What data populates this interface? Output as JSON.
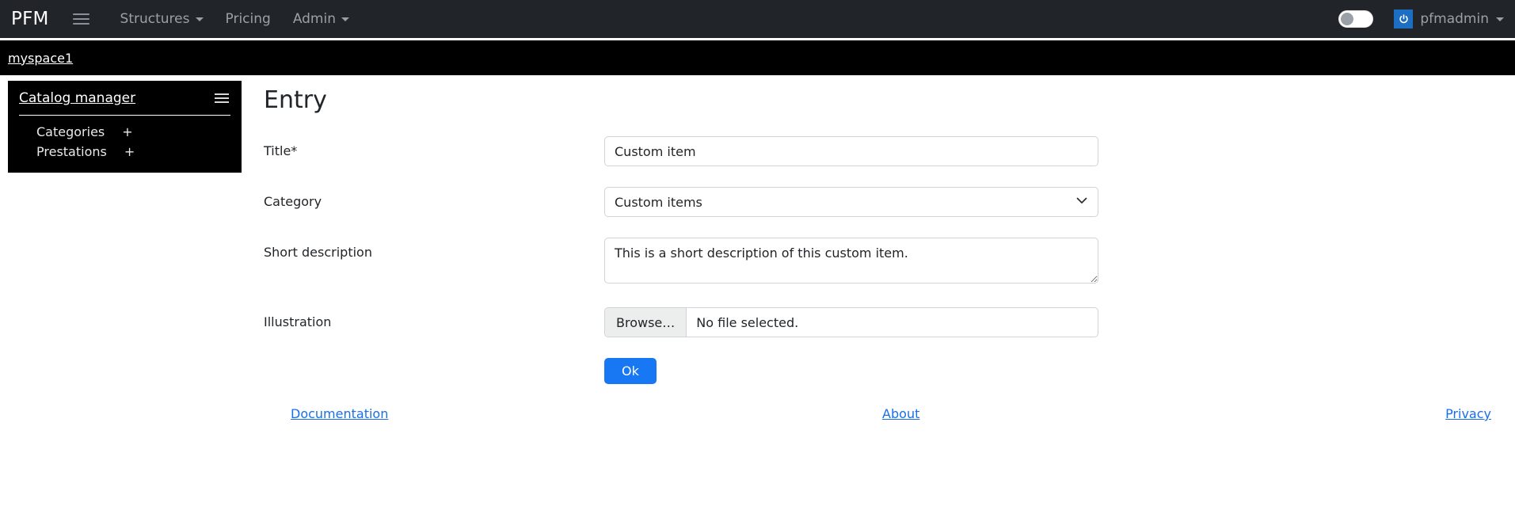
{
  "navbar": {
    "brand": "PFM",
    "menu_icon": "hamburger-icon",
    "items": [
      {
        "label": "Structures",
        "has_caret": true
      },
      {
        "label": "Pricing",
        "has_caret": false
      },
      {
        "label": "Admin",
        "has_caret": true
      }
    ],
    "theme_toggle": {
      "state": "off"
    },
    "user": {
      "label": "pfmadmin",
      "icon": "power-icon",
      "icon_bg": "#1b6ec2"
    }
  },
  "breadcrumb": {
    "label": "myspace1"
  },
  "sidebar": {
    "title": "Catalog manager",
    "menu_icon": "hamburger-icon",
    "items": [
      {
        "label": "Categories",
        "action": "+"
      },
      {
        "label": "Prestations",
        "action": "+"
      }
    ]
  },
  "main": {
    "title": "Entry",
    "fields": {
      "title": {
        "label": "Title*",
        "value": "Custom item",
        "placeholder": ""
      },
      "category": {
        "label": "Category",
        "value": "Custom items",
        "options": [
          "Custom items"
        ]
      },
      "short_description": {
        "label": "Short description",
        "value": "This is a short description of this custom item.",
        "placeholder": ""
      },
      "illustration": {
        "label": "Illustration",
        "browse_label": "Browse…",
        "file_status": "No file selected."
      }
    },
    "submit": {
      "label": "Ok",
      "color": "#1877f2"
    }
  },
  "footer": {
    "links": [
      {
        "label": "Documentation"
      },
      {
        "label": "About"
      },
      {
        "label": "Privacy"
      }
    ],
    "link_color": "#1a6fe8"
  }
}
